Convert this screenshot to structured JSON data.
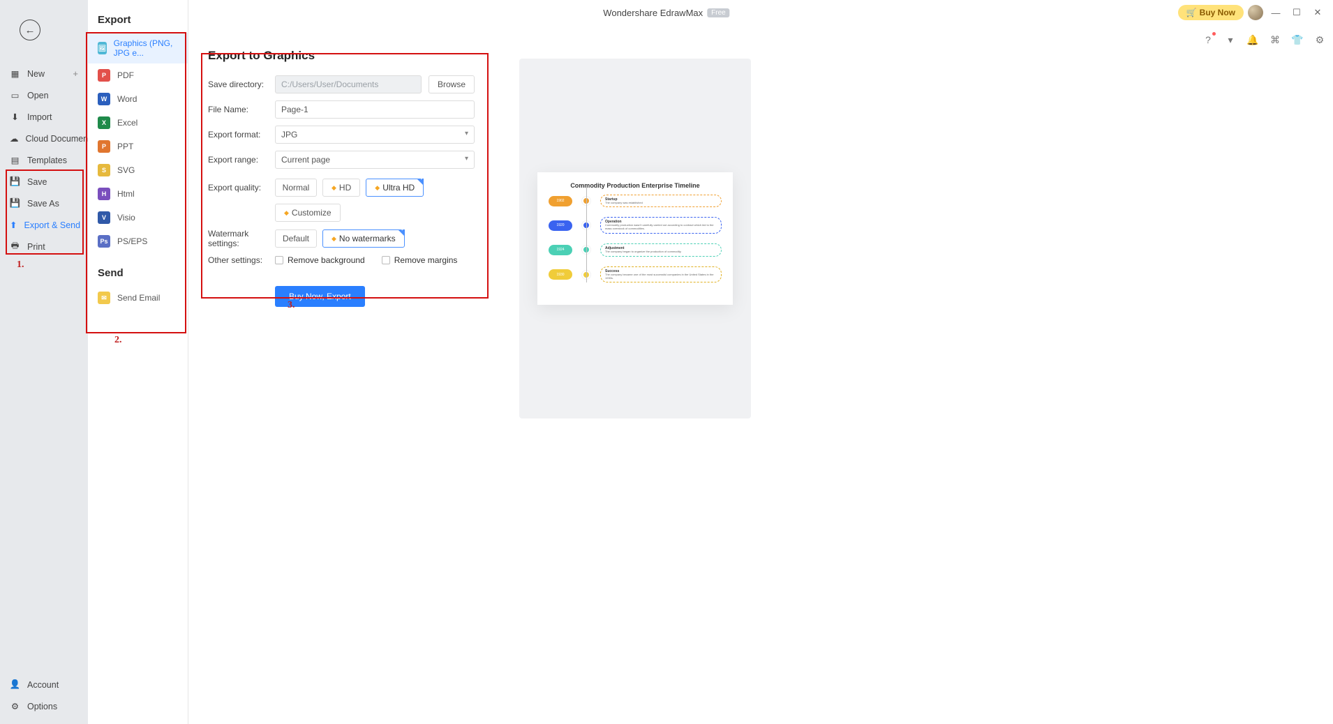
{
  "app": {
    "title": "Wondershare EdrawMax",
    "badge": "Free",
    "buy_now": "Buy Now"
  },
  "nav": {
    "items": [
      {
        "label": "New"
      },
      {
        "label": "Open"
      },
      {
        "label": "Import"
      },
      {
        "label": "Cloud Documents"
      },
      {
        "label": "Templates"
      },
      {
        "label": "Save"
      },
      {
        "label": "Save As"
      },
      {
        "label": "Export & Send"
      },
      {
        "label": "Print"
      }
    ],
    "account": "Account",
    "options": "Options"
  },
  "export_panel": {
    "export_title": "Export",
    "send_title": "Send",
    "items": [
      {
        "label": "Graphics (PNG, JPG e..."
      },
      {
        "label": "PDF"
      },
      {
        "label": "Word"
      },
      {
        "label": "Excel"
      },
      {
        "label": "PPT"
      },
      {
        "label": "SVG"
      },
      {
        "label": "Html"
      },
      {
        "label": "Visio"
      },
      {
        "label": "PS/EPS"
      }
    ],
    "send_items": [
      {
        "label": "Send Email"
      }
    ]
  },
  "form": {
    "title": "Export to Graphics",
    "save_dir_label": "Save directory:",
    "save_dir_value": "C:/Users/User/Documents",
    "browse": "Browse",
    "filename_label": "File Name:",
    "filename_value": "Page-1",
    "format_label": "Export format:",
    "format_value": "JPG",
    "range_label": "Export range:",
    "range_value": "Current page",
    "quality_label": "Export quality:",
    "quality_normal": "Normal",
    "quality_hd": "HD",
    "quality_ultra": "Ultra HD",
    "quality_custom": "Customize",
    "watermark_label": "Watermark settings:",
    "watermark_default": "Default",
    "watermark_none": "No watermarks",
    "other_label": "Other settings:",
    "remove_bg": "Remove background",
    "remove_margins": "Remove margins",
    "action": "Buy Now, Export"
  },
  "preview": {
    "title": "Commodity Production Enterprise Timeline",
    "rows": [
      {
        "year": "1902",
        "heading": "Startup",
        "text": "The company was established",
        "color": "#f0a030",
        "border": "#f0a030"
      },
      {
        "year": "1920",
        "heading": "Operation",
        "text": "Commodity production wasn't carefully carried out according to contract which led to the mass overstock of commodities.",
        "color": "#3a63f0",
        "border": "#3a63f0"
      },
      {
        "year": "1924",
        "heading": "Adjustment",
        "text": "The company began to organize the production of commodity.",
        "color": "#4bd0b5",
        "border": "#4bd0b5"
      },
      {
        "year": "1930",
        "heading": "Success",
        "text": "The company became one of the most successful companies in the United States in the 1930s.",
        "color": "#f0cc3a",
        "border": "#e0b020"
      }
    ]
  },
  "annotations": {
    "box1": "1.",
    "box2": "2.",
    "box3": "3."
  }
}
